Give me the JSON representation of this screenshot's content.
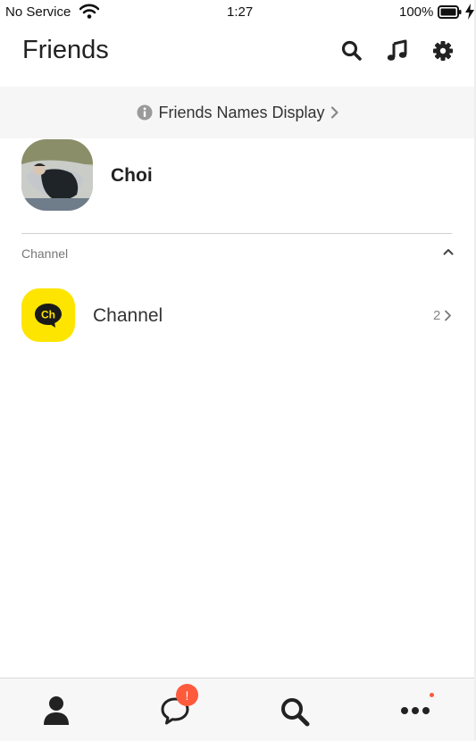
{
  "status_bar": {
    "carrier": "No Service",
    "time": "1:27",
    "battery": "100%"
  },
  "header": {
    "title": "Friends",
    "icons": [
      "search-icon",
      "music-icon",
      "gear-icon"
    ]
  },
  "names_banner": {
    "label": "Friends Names Display",
    "icon": "info-icon"
  },
  "profile": {
    "name": "Choi"
  },
  "channel_section": {
    "header": "Channel",
    "item_label": "Channel",
    "item_icon_text": "Ch",
    "count": "2"
  },
  "tab_bar": {
    "tabs": [
      "person-icon",
      "chat-icon",
      "search-icon",
      "more-icon"
    ],
    "chat_badge": "!"
  },
  "colors": {
    "channel_yellow": "#fee500",
    "badge_red": "#ff5a3c"
  }
}
